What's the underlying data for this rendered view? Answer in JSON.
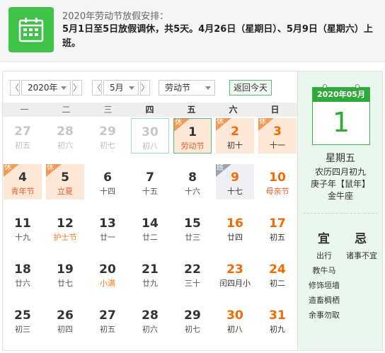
{
  "notice": {
    "icon": "calendar-grid-icon",
    "title": "2020年劳动节放假安排：",
    "text": "5月1日至5日放假调休，共5天。4月26日（星期日）、5月9日（星期六）上班。"
  },
  "toolbar": {
    "prev_year": "〈",
    "year": "2020年",
    "next_year": "〉",
    "prev_month": "〈",
    "month": "5月",
    "next_month": "〉",
    "holiday_select": "劳动节",
    "today_button": "返回今天"
  },
  "weekdays": [
    "一",
    "二",
    "三",
    "四",
    "五",
    "六",
    "日"
  ],
  "weeks": [
    [
      {
        "num": "27",
        "sub": "初五",
        "kind": "other"
      },
      {
        "num": "28",
        "sub": "初六",
        "kind": "other"
      },
      {
        "num": "29",
        "sub": "初七",
        "kind": "other"
      },
      {
        "num": "30",
        "sub": "初八",
        "kind": "other",
        "outline": "today"
      },
      {
        "num": "1",
        "sub": "劳动节",
        "kind": "normal",
        "style": "holiday",
        "tag": "休",
        "outline": "selected",
        "subColor": "red"
      },
      {
        "num": "2",
        "sub": "初十",
        "kind": "weekend",
        "style": "holiday",
        "tag": "休"
      },
      {
        "num": "3",
        "sub": "十一",
        "kind": "weekend",
        "style": "holiday",
        "tag": "休"
      }
    ],
    [
      {
        "num": "4",
        "sub": "青年节",
        "kind": "normal",
        "style": "holiday",
        "tag": "休",
        "subColor": "red"
      },
      {
        "num": "5",
        "sub": "立夏",
        "kind": "normal",
        "style": "holiday",
        "tag": "休",
        "subColor": "red"
      },
      {
        "num": "6",
        "sub": "十四",
        "kind": "normal"
      },
      {
        "num": "7",
        "sub": "十五",
        "kind": "normal"
      },
      {
        "num": "8",
        "sub": "十六",
        "kind": "normal"
      },
      {
        "num": "9",
        "sub": "十七",
        "kind": "weekend",
        "style": "workday",
        "tag": "班"
      },
      {
        "num": "10",
        "sub": "母亲节",
        "kind": "weekend",
        "subColor": "red"
      }
    ],
    [
      {
        "num": "11",
        "sub": "十九",
        "kind": "normal"
      },
      {
        "num": "12",
        "sub": "护士节",
        "kind": "normal",
        "subColor": "orange"
      },
      {
        "num": "13",
        "sub": "廿一",
        "kind": "normal"
      },
      {
        "num": "14",
        "sub": "廿二",
        "kind": "normal"
      },
      {
        "num": "15",
        "sub": "廿三",
        "kind": "normal"
      },
      {
        "num": "16",
        "sub": "廿四",
        "kind": "weekend"
      },
      {
        "num": "17",
        "sub": "初五",
        "kind": "weekend"
      }
    ],
    [
      {
        "num": "18",
        "sub": "廿六",
        "kind": "normal"
      },
      {
        "num": "19",
        "sub": "廿七",
        "kind": "normal"
      },
      {
        "num": "20",
        "sub": "小满",
        "kind": "normal",
        "subColor": "orange"
      },
      {
        "num": "21",
        "sub": "廿九",
        "kind": "normal"
      },
      {
        "num": "22",
        "sub": "三十",
        "kind": "normal"
      },
      {
        "num": "23",
        "sub": "闰四月小",
        "kind": "weekend"
      },
      {
        "num": "24",
        "sub": "初二",
        "kind": "weekend"
      }
    ],
    [
      {
        "num": "25",
        "sub": "初三",
        "kind": "normal"
      },
      {
        "num": "26",
        "sub": "初四",
        "kind": "normal"
      },
      {
        "num": "27",
        "sub": "初五",
        "kind": "normal"
      },
      {
        "num": "28",
        "sub": "初六",
        "kind": "normal"
      },
      {
        "num": "29",
        "sub": "初七",
        "kind": "normal"
      },
      {
        "num": "30",
        "sub": "初八",
        "kind": "weekend"
      },
      {
        "num": "31",
        "sub": "初九",
        "kind": "weekend"
      }
    ]
  ],
  "panel": {
    "header": "2020年05月",
    "day": "1",
    "weekday": "星期五",
    "lunar": "农历四月初九",
    "ganzhi": "庚子年【鼠年】",
    "zodiac": "金牛座",
    "yi_label": "宜",
    "ji_label": "忌",
    "yi": [
      "出行",
      "教牛马",
      "修饰垣墙",
      "造畜椆栖",
      "余事勿取"
    ],
    "ji": [
      "诸事不宜"
    ]
  },
  "colors": {
    "accent_green": "#3ec248",
    "holiday_bg": "#fde8d8",
    "workday_bg": "#eef0f5",
    "weekend_text": "#f56a00",
    "panel_bg": "#eaf7ec"
  }
}
